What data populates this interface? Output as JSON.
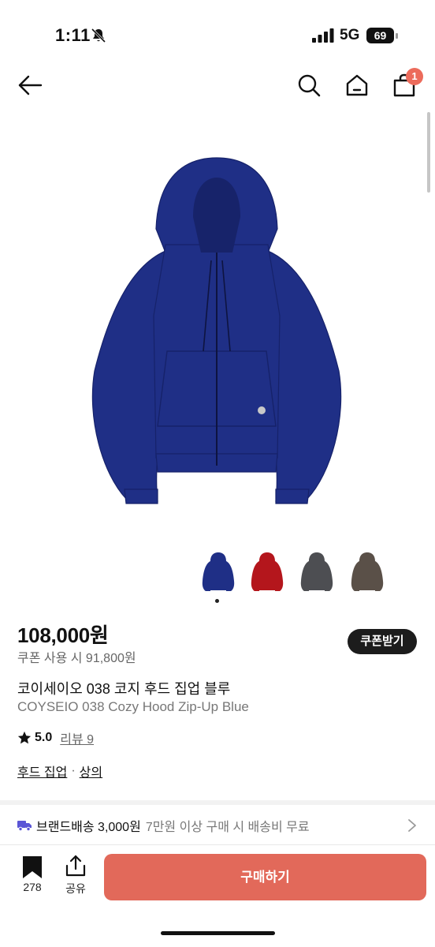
{
  "status_bar": {
    "time": "1:11",
    "network": "5G",
    "battery": "69"
  },
  "nav": {
    "cart_count": "1"
  },
  "product": {
    "price": "108,000원",
    "coupon_price": "쿠폰 사용 시 91,800원",
    "coupon_button": "쿠폰받기",
    "title_ko": "코이세이오 038 코지 후드 집업 블루",
    "title_en": "COYSEIO 038 Cozy Hood Zip-Up Blue",
    "rating": "5.0",
    "review_label": "리뷰 9",
    "categories": [
      "후드 집업",
      "상의"
    ],
    "category_separator": "·",
    "color_variants": [
      {
        "name": "blue",
        "color": "#1f2f86"
      },
      {
        "name": "red",
        "color": "#b4161c"
      },
      {
        "name": "charcoal",
        "color": "#4d4e52"
      },
      {
        "name": "brown",
        "color": "#5a5048"
      }
    ],
    "main_color": "#1f2f86"
  },
  "shipping": {
    "label": "브랜드배송 3,000원",
    "note": "7만원 이상 구매 시 배송비 무료"
  },
  "bottom_bar": {
    "bookmark_count": "278",
    "share_label": "공유",
    "buy_label": "구매하기"
  },
  "colors": {
    "accent": "#e2695a",
    "badge": "#ec6b5b",
    "dark_button": "#1c1c1c",
    "shipping_icon": "#5a55d6"
  }
}
